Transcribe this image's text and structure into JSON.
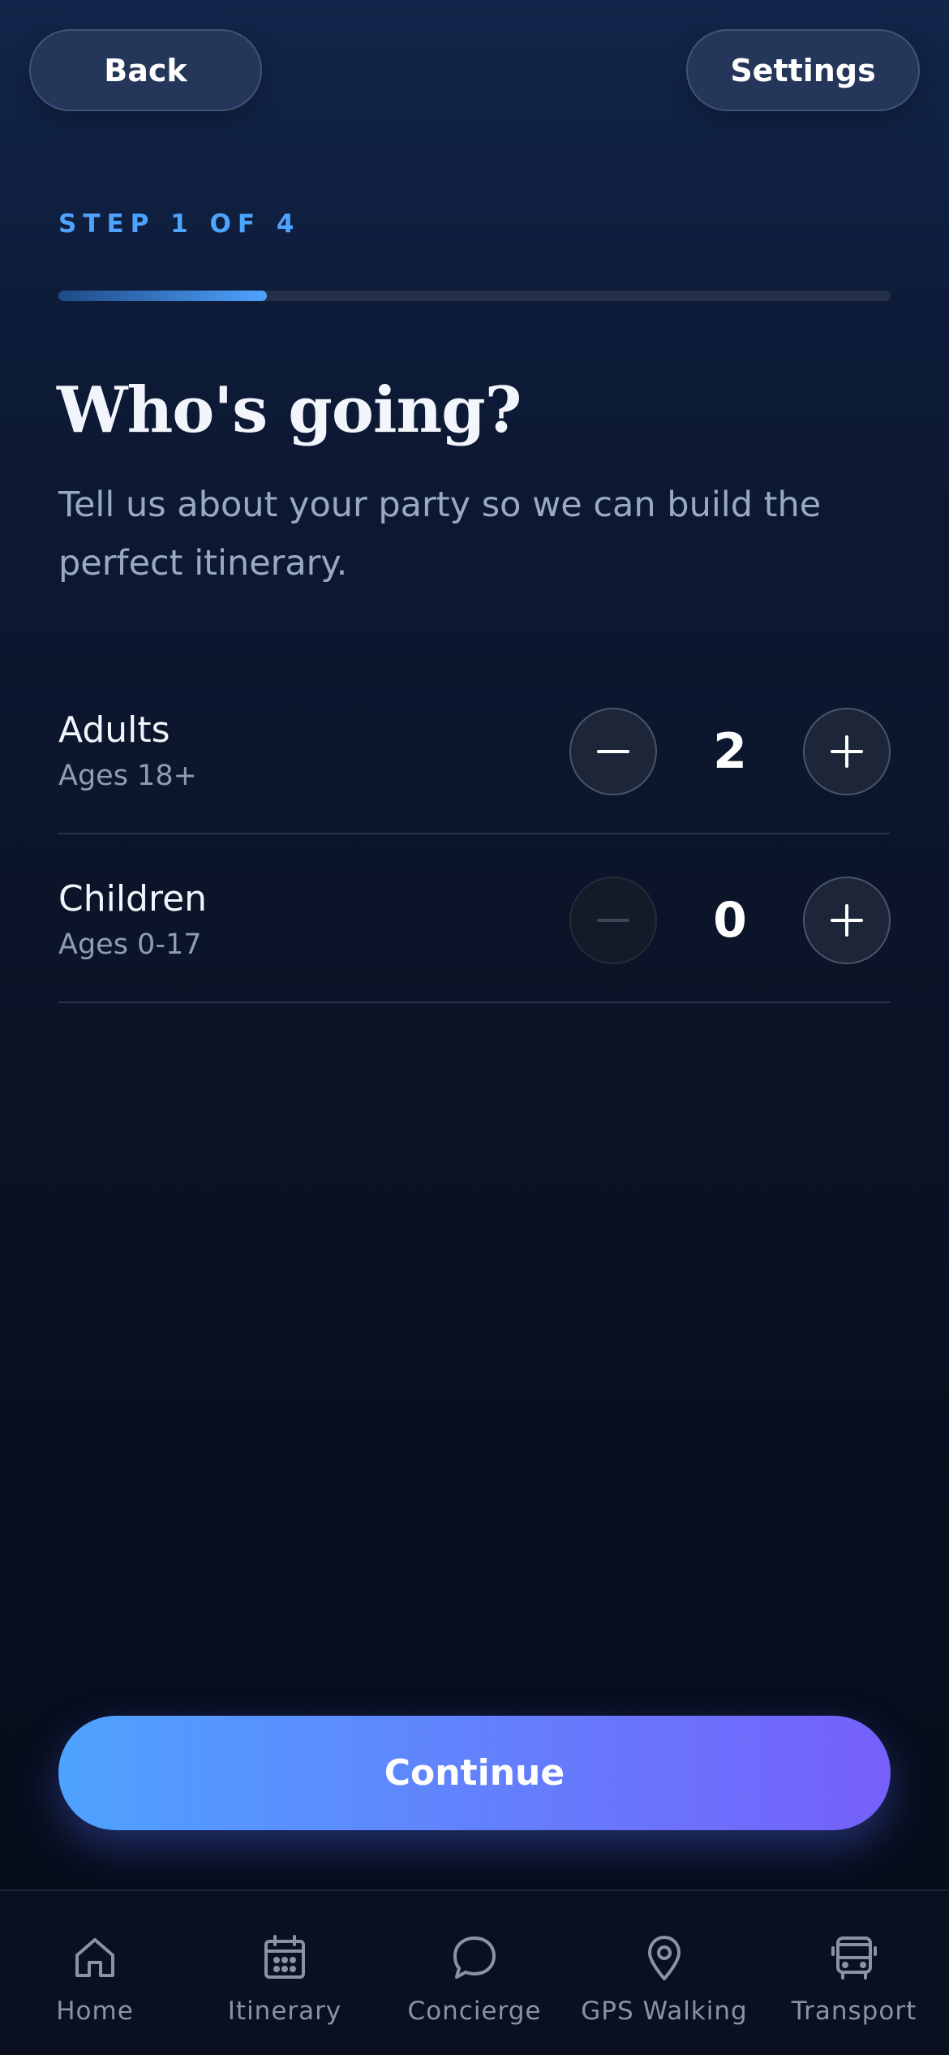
{
  "header": {
    "back_label": "Back",
    "settings_label": "Settings"
  },
  "progress": {
    "step_label": "STEP 1 OF 4",
    "fraction": 0.25
  },
  "intro": {
    "title": "Who's going?",
    "subtitle": "Tell us about your party so we can build the perfect itinerary."
  },
  "party": {
    "adults": {
      "label": "Adults",
      "sublabel": "Ages 18+",
      "count": "2",
      "minus_enabled": true
    },
    "children": {
      "label": "Children",
      "sublabel": "Ages 0-17",
      "count": "0",
      "minus_enabled": false
    }
  },
  "actions": {
    "continue_label": "Continue"
  },
  "tabbar": {
    "items": [
      {
        "label": "Home",
        "icon": "home-icon"
      },
      {
        "label": "Itinerary",
        "icon": "calendar-icon"
      },
      {
        "label": "Concierge",
        "icon": "chat-bubble-icon"
      },
      {
        "label": "GPS Walking",
        "icon": "map-pin-icon"
      },
      {
        "label": "Transport",
        "icon": "bus-icon"
      }
    ]
  },
  "colors": {
    "accent": "#4ea3ff",
    "gradient_end": "#7660fb",
    "background": "#0b1428"
  }
}
